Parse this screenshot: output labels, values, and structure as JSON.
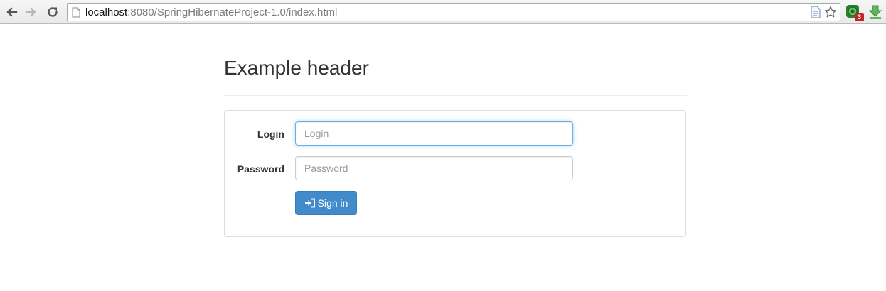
{
  "browser": {
    "url_host": "localhost",
    "url_rest": ":8080/SpringHibernateProject-1.0/index.html",
    "extension_badge": "3",
    "icons": {
      "back": "back-arrow-icon",
      "forward": "forward-arrow-icon",
      "reload": "reload-icon",
      "page": "page-icon",
      "doc": "document-icon",
      "star": "bookmark-star-icon",
      "extension": "extension-icon",
      "download": "download-arrow-icon"
    }
  },
  "page": {
    "header": "Example header"
  },
  "form": {
    "login_label": "Login",
    "login_placeholder": "Login",
    "login_value": "",
    "password_label": "Password",
    "password_placeholder": "Password",
    "password_value": "",
    "signin_label": "Sign in",
    "signin_icon": "sign-in-icon"
  },
  "colors": {
    "primary_button": "#428bca",
    "focus_border": "#66afe9"
  }
}
